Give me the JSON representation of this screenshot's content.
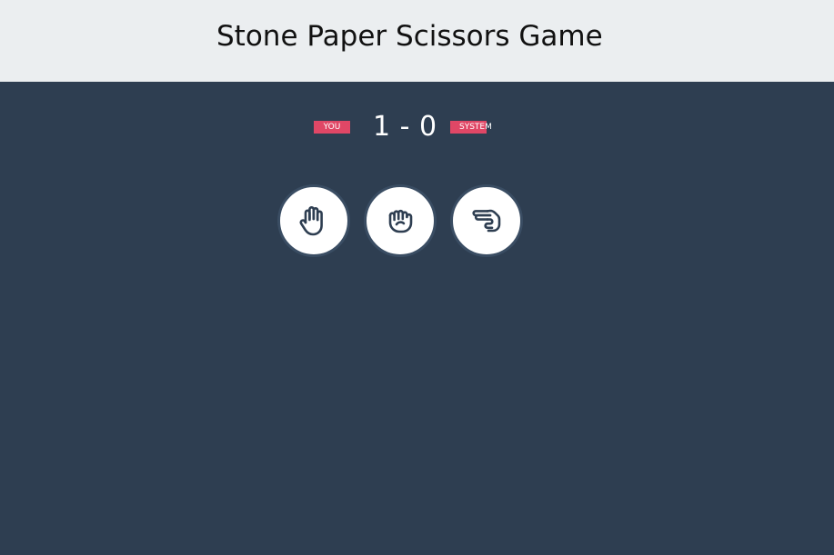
{
  "header": {
    "title": "Stone Paper Scissors Game"
  },
  "scoreboard": {
    "you_label": "YOU",
    "system_label": "SYSTEM",
    "score_text": "1 - 0",
    "user_score": 1,
    "system_score": 0,
    "badge_color": "#e04766"
  },
  "choices": [
    {
      "name": "paper",
      "icon": "hand-paper-icon"
    },
    {
      "name": "stone",
      "icon": "hand-rock-icon"
    },
    {
      "name": "scissors",
      "icon": "hand-scissors-icon"
    }
  ],
  "colors": {
    "background": "#2e3e51",
    "header_bg": "#ebeef0",
    "icon_stroke": "#2e3e51"
  }
}
